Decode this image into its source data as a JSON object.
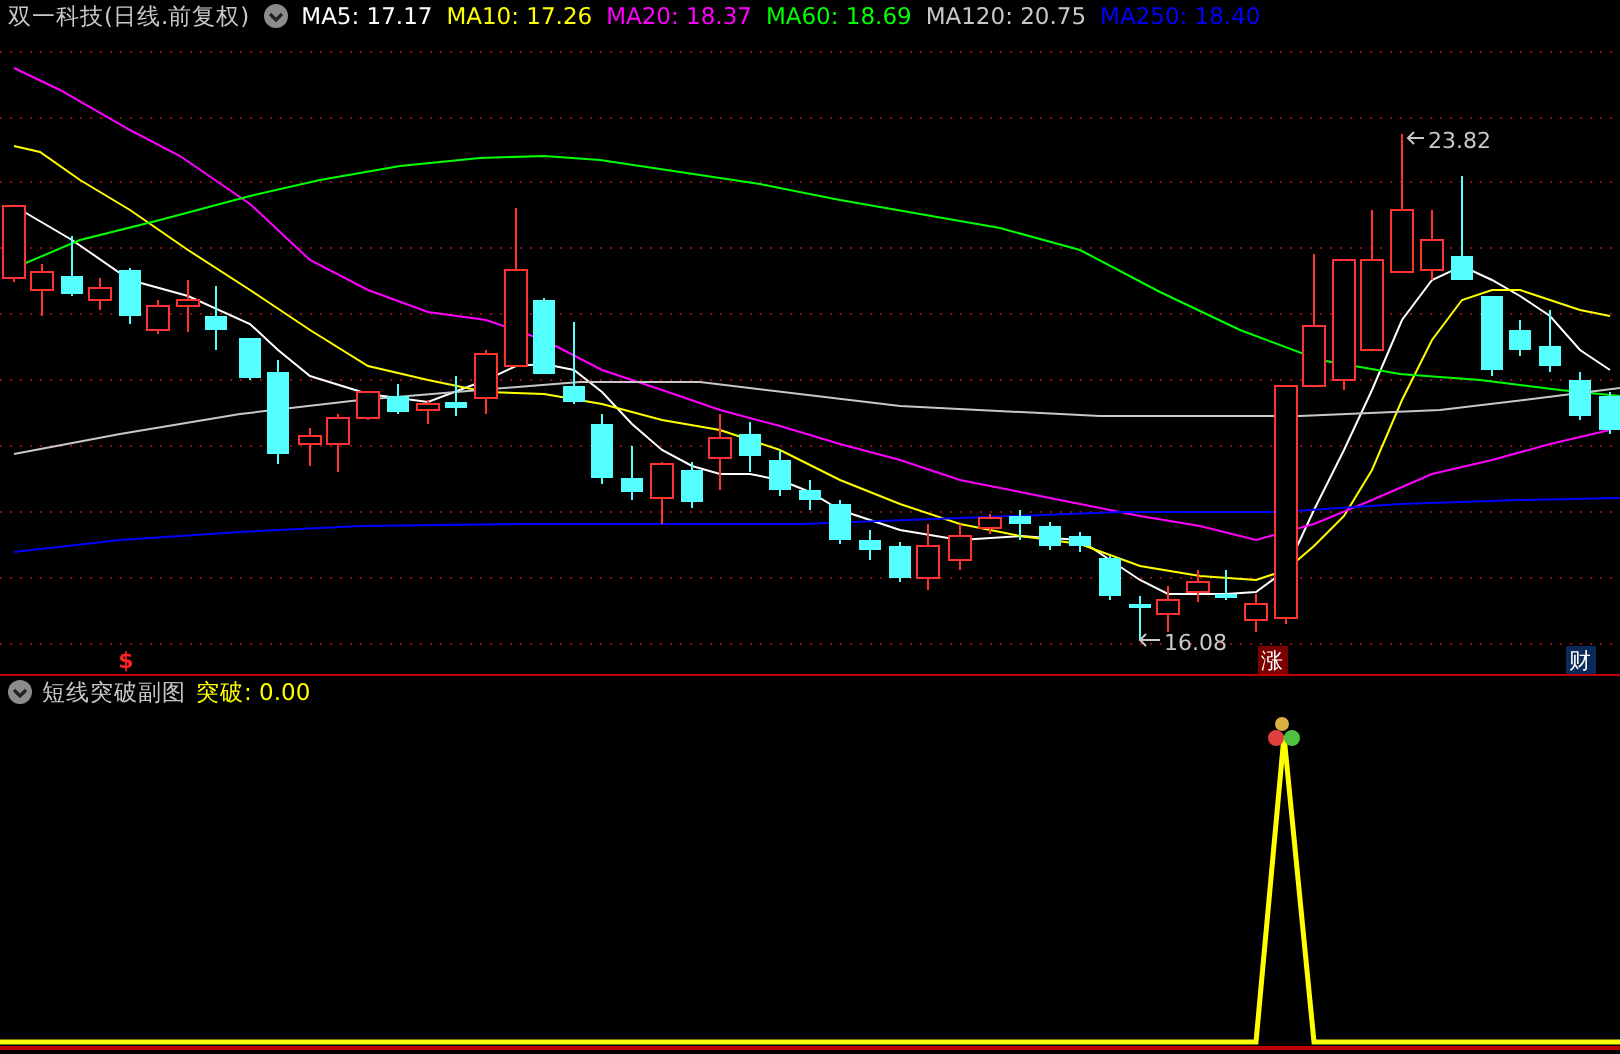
{
  "title": "双一科技(日线.前复权)",
  "legend": [
    {
      "label": "MA5: 17.17",
      "color": "#ffffff"
    },
    {
      "label": "MA10: 17.26",
      "color": "#ffff00"
    },
    {
      "label": "MA20: 18.37",
      "color": "#ff00ff"
    },
    {
      "label": "MA60: 18.69",
      "color": "#00ff00"
    },
    {
      "label": "MA120: 20.75",
      "color": "#c8c8c8"
    },
    {
      "label": "MA250: 18.40",
      "color": "#0000ff"
    }
  ],
  "price_labels": {
    "high": "23.82",
    "low": "16.08"
  },
  "markers": [
    {
      "kind": "dollar",
      "text": "$"
    },
    {
      "kind": "rise",
      "text": "涨"
    },
    {
      "kind": "finance",
      "text": "财"
    }
  ],
  "indicator": {
    "title": "短线突破副图",
    "reading": "突破: 0.00"
  }
}
